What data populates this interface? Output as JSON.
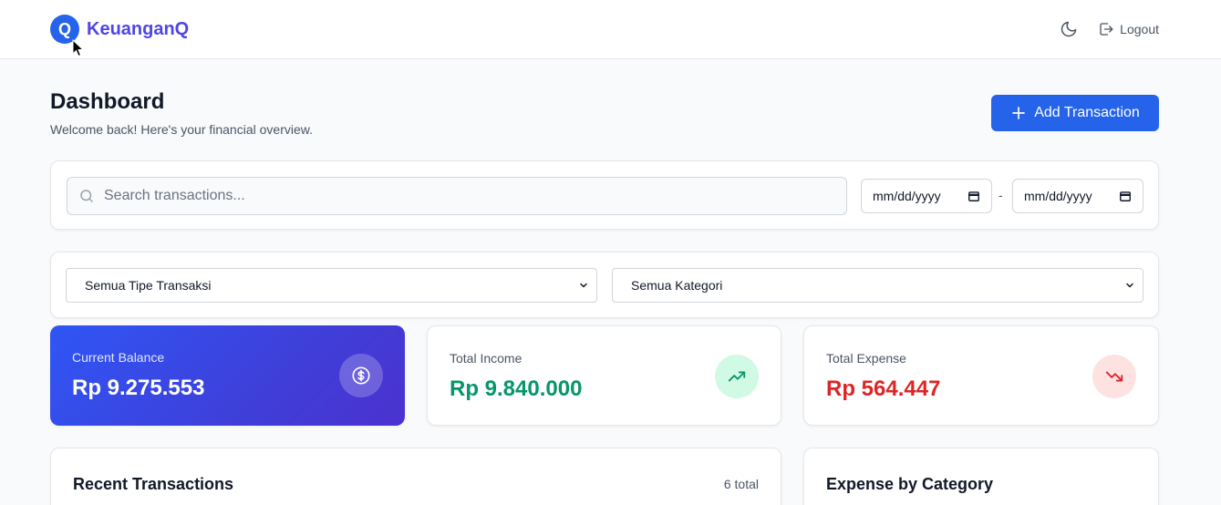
{
  "brand": {
    "logo_letter": "Q",
    "name": "KeuanganQ"
  },
  "nav": {
    "logout_label": "Logout"
  },
  "header": {
    "title": "Dashboard",
    "subtitle": "Welcome back! Here's your financial overview.",
    "add_button_label": "Add Transaction"
  },
  "search": {
    "placeholder": "Search transactions...",
    "date_from_placeholder": "mm/dd/yyyy",
    "date_separator": "-",
    "date_to_placeholder": "mm/dd/yyyy"
  },
  "filters": {
    "type_selected": "Semua Tipe Transaksi",
    "category_selected": "Semua Kategori"
  },
  "stats": {
    "balance": {
      "label": "Current Balance",
      "value": "Rp 9.275.553"
    },
    "income": {
      "label": "Total Income",
      "value": "Rp 9.840.000"
    },
    "expense": {
      "label": "Total Expense",
      "value": "Rp 564.447"
    }
  },
  "recent": {
    "title": "Recent Transactions",
    "count": "6 total"
  },
  "category": {
    "title": "Expense by Category"
  },
  "colors": {
    "primary": "#2563eb",
    "brand_text": "#4f46e5",
    "income": "#059669",
    "expense": "#dc2626"
  },
  "icons": {
    "theme": "moon-icon",
    "logout": "logout-icon",
    "add": "plus-icon",
    "search": "search-icon",
    "calendar": "calendar-icon",
    "balance": "dollar-icon",
    "income": "trending-up-icon",
    "expense": "trending-down-icon"
  }
}
